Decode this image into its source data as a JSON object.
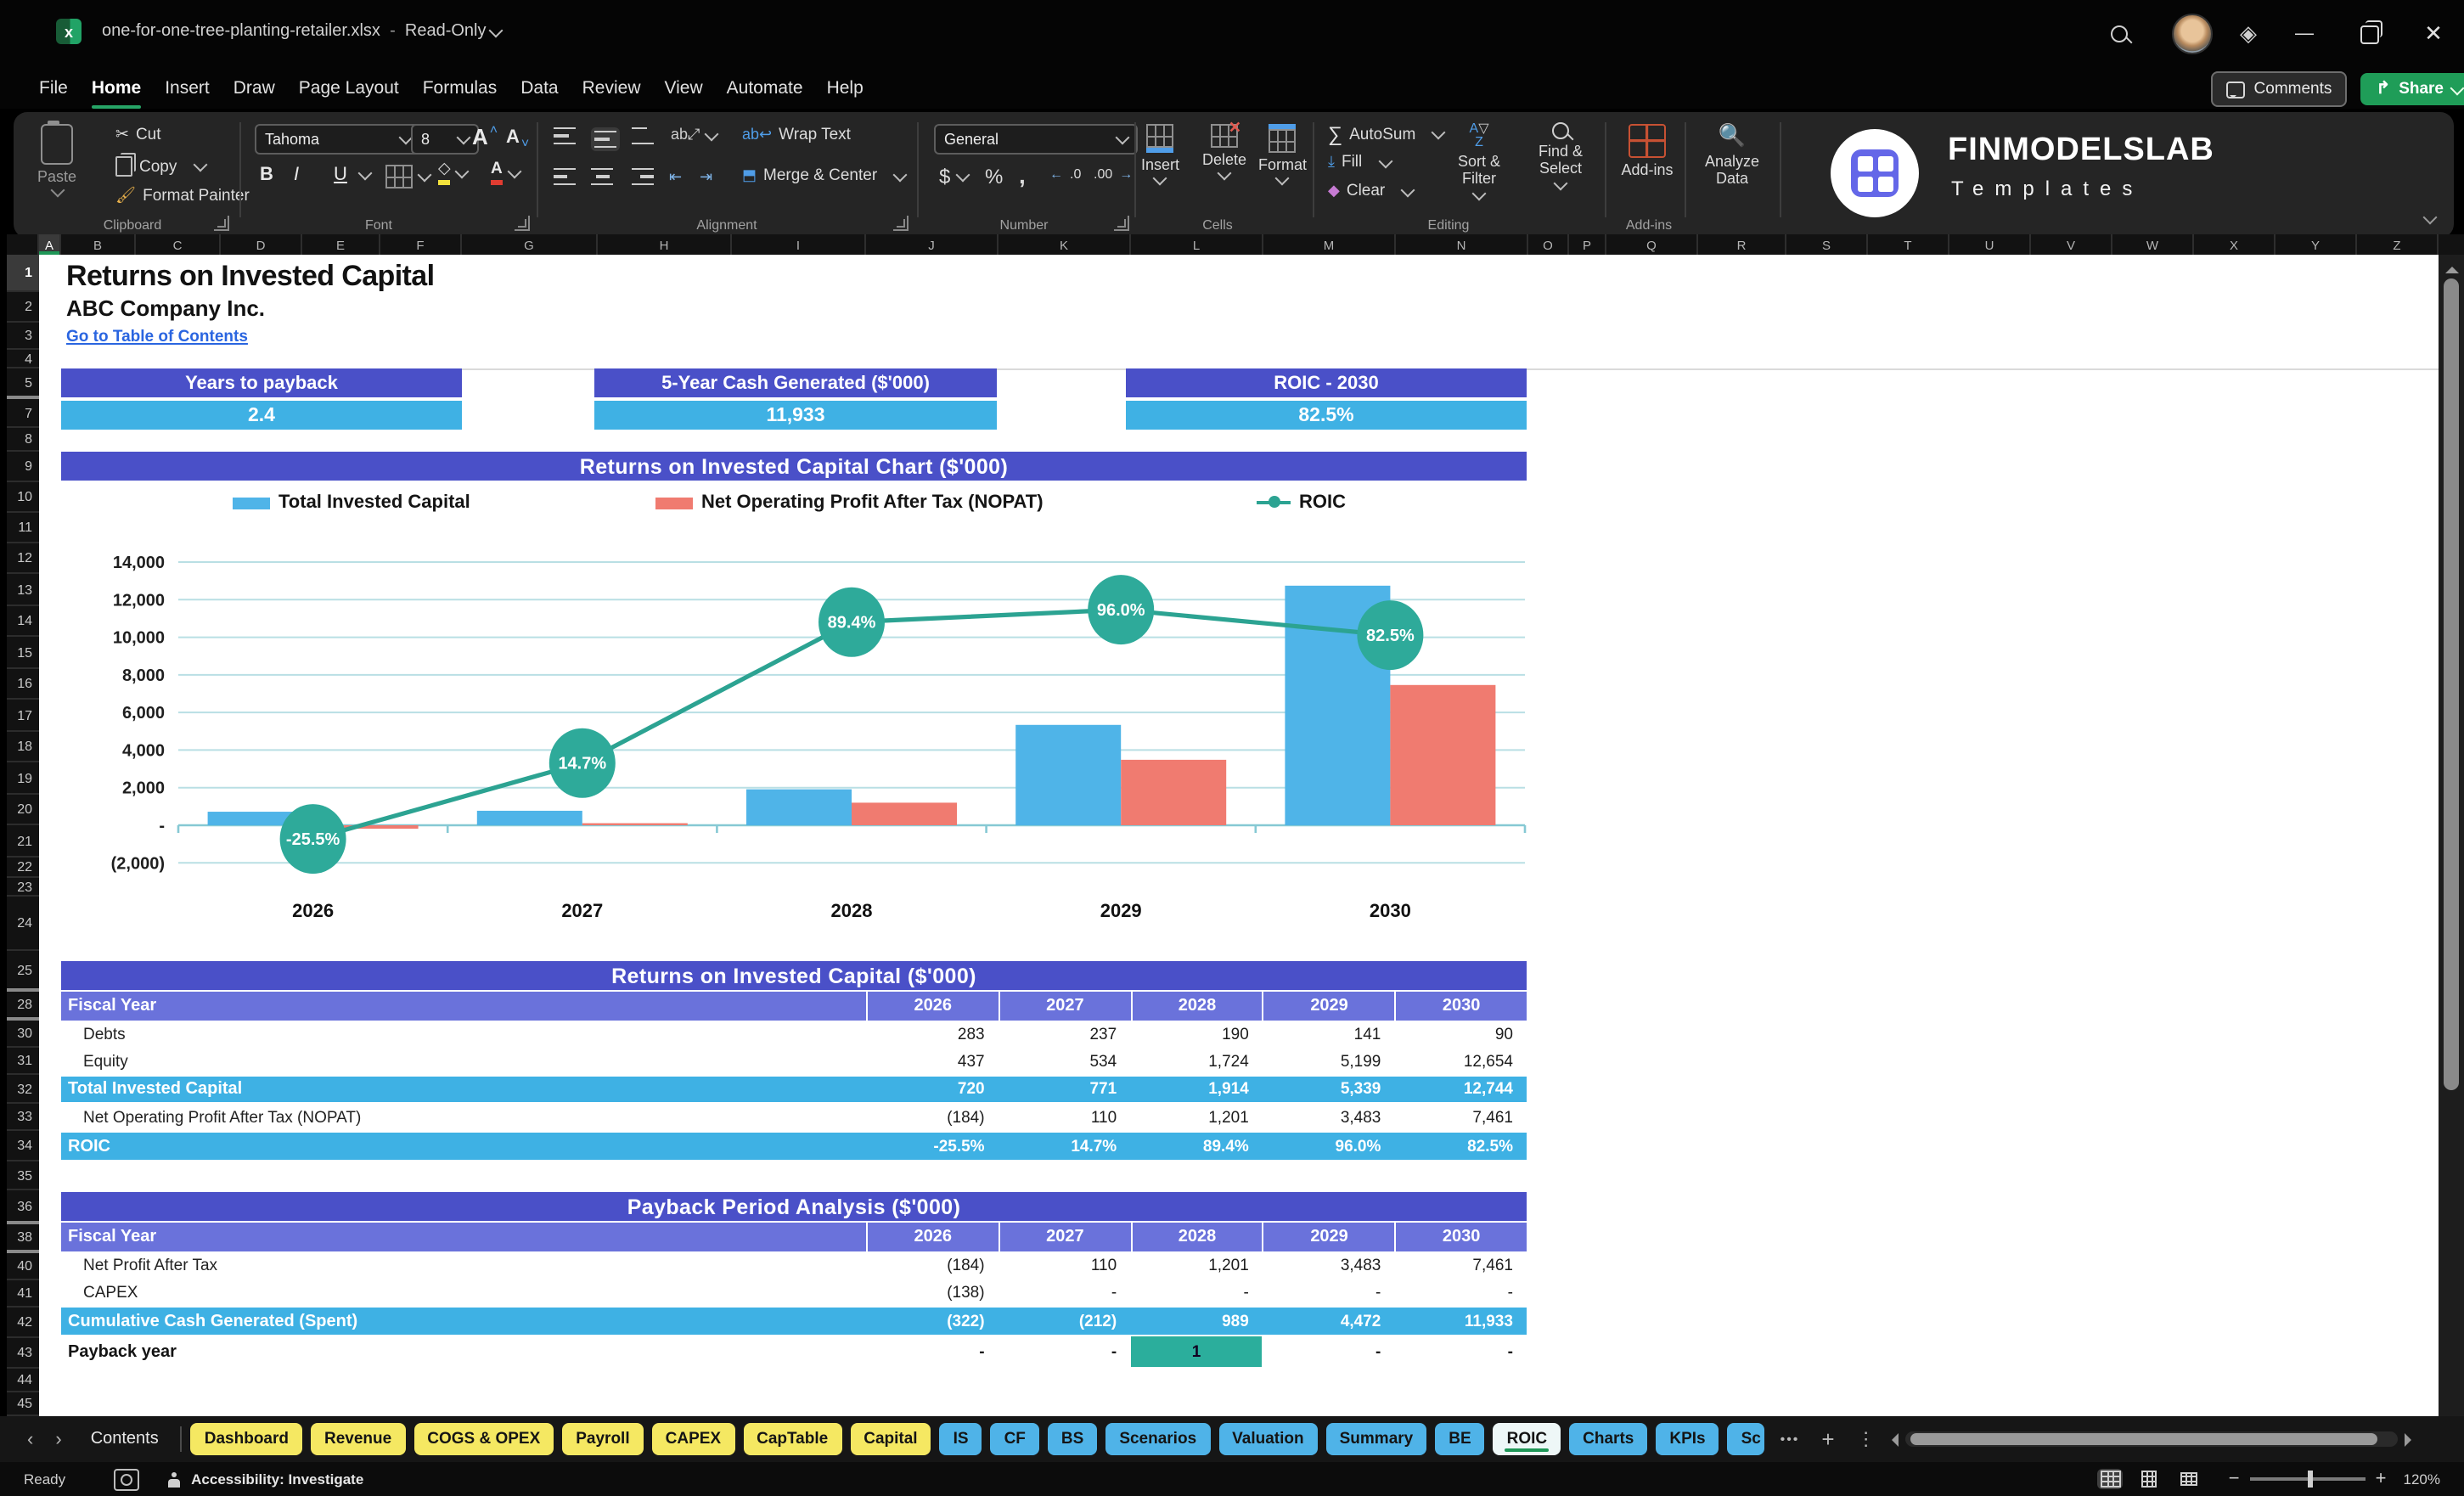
{
  "titlebar": {
    "filename": "one-for-one-tree-planting-retailer.xlsx",
    "separator": "-",
    "mode": "Read-Only"
  },
  "menubar": {
    "items": [
      "File",
      "Home",
      "Insert",
      "Draw",
      "Page Layout",
      "Formulas",
      "Data",
      "Review",
      "View",
      "Automate",
      "Help"
    ],
    "active": "Home",
    "comments_label": "Comments",
    "share_label": "Share"
  },
  "ribbon": {
    "clipboard": {
      "paste": "Paste",
      "cut": "Cut",
      "copy": "Copy",
      "format_painter": "Format Painter",
      "label": "Clipboard"
    },
    "font": {
      "family": "Tahoma",
      "size": "8",
      "bold": "B",
      "italic": "I",
      "underline": "U",
      "label": "Font"
    },
    "alignment": {
      "wrap": "Wrap Text",
      "merge": "Merge & Center",
      "label": "Alignment"
    },
    "number": {
      "format": "General",
      "label": "Number"
    },
    "cells": {
      "insert": "Insert",
      "delete": "Delete",
      "format": "Format",
      "label": "Cells"
    },
    "editing": {
      "autosum": "AutoSum",
      "fill": "Fill",
      "clear": "Clear",
      "sort": "Sort & Filter",
      "find": "Find & Select",
      "label": "Editing"
    },
    "addins": {
      "addins": "Add-ins",
      "analyze": "Analyze Data",
      "label": "Add-ins"
    }
  },
  "brand": {
    "name": "FINMODELSLAB",
    "sub": "Templates"
  },
  "grid": {
    "columns": [
      "A",
      "B",
      "C",
      "D",
      "E",
      "F",
      "G",
      "H",
      "I",
      "J",
      "K",
      "L",
      "M",
      "N",
      "O",
      "P",
      "Q",
      "R",
      "S",
      "T",
      "U",
      "V",
      "W",
      "X",
      "Y",
      "Z"
    ],
    "rows": [
      "1",
      "2",
      "3",
      "4",
      "5",
      "7",
      "8",
      "9",
      "10",
      "11",
      "12",
      "13",
      "14",
      "15",
      "16",
      "17",
      "18",
      "19",
      "20",
      "21",
      "22",
      "23",
      "24",
      "25",
      "28",
      "30",
      "31",
      "32",
      "33",
      "34",
      "35",
      "36",
      "38",
      "40",
      "41",
      "42",
      "43",
      "44",
      "45"
    ]
  },
  "content": {
    "title": "Returns on Invested Capital",
    "company": "ABC Company Inc.",
    "link": "Go to Table of Contents",
    "kpis": [
      {
        "label": "Years to payback",
        "value": "2.4"
      },
      {
        "label": "5-Year Cash Generated ($'000)",
        "value": "11,933"
      },
      {
        "label": "ROIC - 2030",
        "value": "82.5%"
      }
    ]
  },
  "chart_data": {
    "type": "combo",
    "title": "Returns on Invested Capital Chart ($'000)",
    "categories": [
      "2026",
      "2027",
      "2028",
      "2029",
      "2030"
    ],
    "bar_series": [
      {
        "name": "Total Invested Capital",
        "color": "#4FB4E8",
        "values": [
          720,
          771,
          1914,
          5339,
          12744
        ]
      },
      {
        "name": "Net Operating Profit After Tax (NOPAT)",
        "color": "#F07B70",
        "values": [
          -184,
          110,
          1201,
          3483,
          7461
        ]
      }
    ],
    "line_series": {
      "name": "ROIC",
      "color": "#2CA392",
      "marker_color": "#2EAA9A",
      "values_pct": [
        -25.5,
        14.7,
        89.4,
        96.0,
        82.5
      ],
      "labels": [
        "-25.5%",
        "14.7%",
        "89.4%",
        "96.0%",
        "82.5%"
      ]
    },
    "y_axis": {
      "min": -2000,
      "max": 14000,
      "step": 2000,
      "tick_labels": [
        "(2,000)",
        "-",
        "2,000",
        "4,000",
        "6,000",
        "8,000",
        "10,000",
        "12,000",
        "14,000"
      ]
    },
    "grid": true,
    "legend_position": "top"
  },
  "tables": [
    {
      "title": "Returns on Invested Capital ($'000)",
      "fiscal_label": "Fiscal Year",
      "years": [
        "2026",
        "2027",
        "2028",
        "2029",
        "2030"
      ],
      "rows": [
        {
          "label": "Debts",
          "style": "plain",
          "values": [
            "283",
            "237",
            "190",
            "141",
            "90"
          ]
        },
        {
          "label": "Equity",
          "style": "plain",
          "values": [
            "437",
            "534",
            "1,724",
            "5,199",
            "12,654"
          ]
        },
        {
          "label": "Total Invested Capital",
          "style": "highlight",
          "values": [
            "720",
            "771",
            "1,914",
            "5,339",
            "12,744"
          ]
        },
        {
          "label": "Net Operating Profit After Tax (NOPAT)",
          "style": "plain",
          "values": [
            "(184)",
            "110",
            "1,201",
            "3,483",
            "7,461"
          ]
        },
        {
          "label": "ROIC",
          "style": "highlight",
          "values": [
            "-25.5%",
            "14.7%",
            "89.4%",
            "96.0%",
            "82.5%"
          ]
        }
      ]
    },
    {
      "title": "Payback Period Analysis ($'000)",
      "fiscal_label": "Fiscal Year",
      "years": [
        "2026",
        "2027",
        "2028",
        "2029",
        "2030"
      ],
      "rows": [
        {
          "label": "Net Profit After Tax",
          "style": "plain",
          "values": [
            "(184)",
            "110",
            "1,201",
            "3,483",
            "7,461"
          ]
        },
        {
          "label": "CAPEX",
          "style": "plain",
          "values": [
            "(138)",
            "-",
            "-",
            "-",
            "-"
          ]
        },
        {
          "label": "Cumulative Cash Generated (Spent)",
          "style": "highlight",
          "values": [
            "(322)",
            "(212)",
            "989",
            "4,472",
            "11,933"
          ]
        },
        {
          "label": "Payback year",
          "style": "bold",
          "values": [
            "-",
            "-",
            "1",
            "-",
            "-"
          ],
          "highlight_cell": 2,
          "highlight_color": "#2BAE9C"
        }
      ]
    }
  ],
  "tabbar": {
    "items": [
      {
        "label": "Contents",
        "type": "plain"
      },
      {
        "label": "Dashboard",
        "type": "yellow"
      },
      {
        "label": "Revenue",
        "type": "yellow"
      },
      {
        "label": "COGS & OPEX",
        "type": "yellow"
      },
      {
        "label": "Payroll",
        "type": "yellow"
      },
      {
        "label": "CAPEX",
        "type": "yellow"
      },
      {
        "label": "CapTable",
        "type": "yellow"
      },
      {
        "label": "Capital",
        "type": "yellow"
      },
      {
        "label": "IS",
        "type": "blue"
      },
      {
        "label": "CF",
        "type": "blue"
      },
      {
        "label": "BS",
        "type": "blue"
      },
      {
        "label": "Scenarios",
        "type": "blue"
      },
      {
        "label": "Valuation",
        "type": "blue"
      },
      {
        "label": "Summary",
        "type": "blue"
      },
      {
        "label": "BE",
        "type": "blue"
      },
      {
        "label": "ROIC",
        "type": "active"
      },
      {
        "label": "Charts",
        "type": "blue"
      },
      {
        "label": "KPIs",
        "type": "blue"
      },
      {
        "label": "Sc",
        "type": "blue",
        "cut": true
      }
    ],
    "more": "•••",
    "add": "+",
    "menu": "⋮"
  },
  "statusbar": {
    "ready": "Ready",
    "accessibility": "Accessibility: Investigate",
    "zoom": "120%",
    "zoom_minus": "−",
    "zoom_plus": "+"
  }
}
